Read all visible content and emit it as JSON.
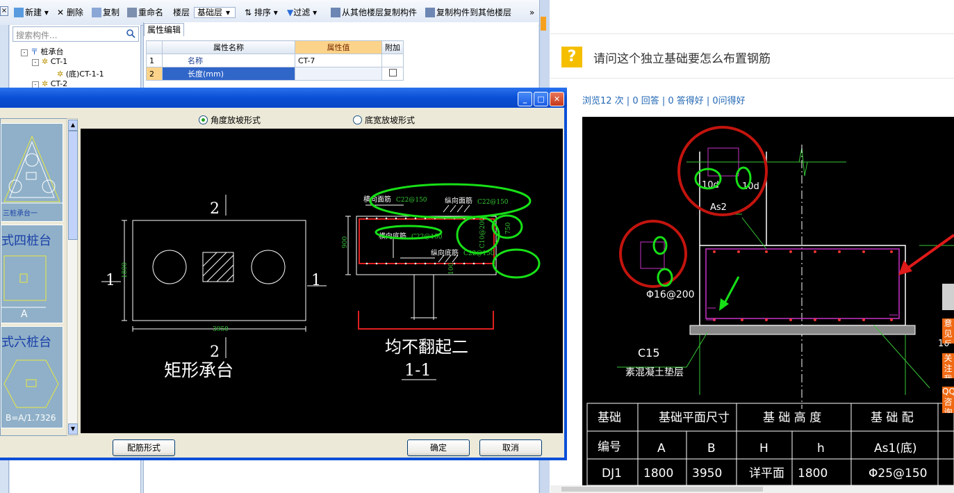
{
  "toolbar": {
    "new": "新建",
    "delete": "删除",
    "copy": "复制",
    "rename": "重命名",
    "floor_label": "楼层",
    "floor_value": "基础层",
    "sort": "排序",
    "filter": "过滤",
    "copy_from": "从其他楼层复制构件",
    "copy_to": "复制构件到其他楼层",
    "more": "»"
  },
  "tree": {
    "search_placeholder": "搜索构件...",
    "items": [
      "桩承台",
      "CT-1",
      "(底)CT-1-1",
      "CT-2"
    ]
  },
  "props": {
    "tab": "属性编辑",
    "headers": [
      "属性名称",
      "属性值",
      "附加"
    ],
    "rows": [
      {
        "num": "1",
        "name": "名称",
        "value": "CT-7"
      },
      {
        "num": "2",
        "name": "长度(mm)",
        "value": ""
      }
    ]
  },
  "dialog": {
    "radio_corner": "角度放坡形式",
    "radio_bottom": "底宽放坡形式",
    "btn_rebar": "配筋形式",
    "btn_ok": "确定",
    "btn_cancel": "取消",
    "thumb_labels": [
      "三桩承台一",
      "式四桩台",
      "A",
      "式六桩台",
      "B=A/1.7326"
    ],
    "drawing": {
      "sec_top": "2",
      "sec_bot": "2",
      "side_left": "1",
      "side_right": "1",
      "dim_h": "1800",
      "dim_w": "3950",
      "caption_left": "矩形承台",
      "caption_right": "均不翻起二",
      "section": "1-1",
      "h_top": "横向面筋",
      "h_top_spec": "C22@150",
      "v_top": "纵向面筋",
      "v_top_spec": "C22@150",
      "h_bot": "横向底筋",
      "h_bot_spec": "C22@150",
      "v_bot": "纵向底筋",
      "v_bot_spec": "C22@150",
      "side_bar": "C10@200",
      "dim_900": "900",
      "dim_750": "750",
      "dim_100": "100"
    }
  },
  "web": {
    "question": "请问这个独立基础要怎么布置钢筋",
    "stats": "浏览12 次 | 0 回答 | 0 答得好 | 0问得好",
    "cad": {
      "label_10d_a": "10d",
      "label_10d_b": "10d",
      "label_as2": "As2",
      "label_rebar": "Φ16@200",
      "label_c15": "C15",
      "label_pad": "素混凝土垫层",
      "label_10": "10",
      "table": {
        "h1": [
          "基础",
          "基础平面尺寸",
          "基 础 高 度",
          "基 础 配"
        ],
        "h2": [
          "编号",
          "A",
          "B",
          "H",
          "h",
          "As1(底)"
        ],
        "row": [
          "DJ1",
          "1800",
          "3950",
          "详平面",
          "1800",
          "Φ25@150"
        ]
      }
    },
    "side_tabs": [
      "意见反馈",
      "关注我们",
      "QQ咨询"
    ]
  }
}
